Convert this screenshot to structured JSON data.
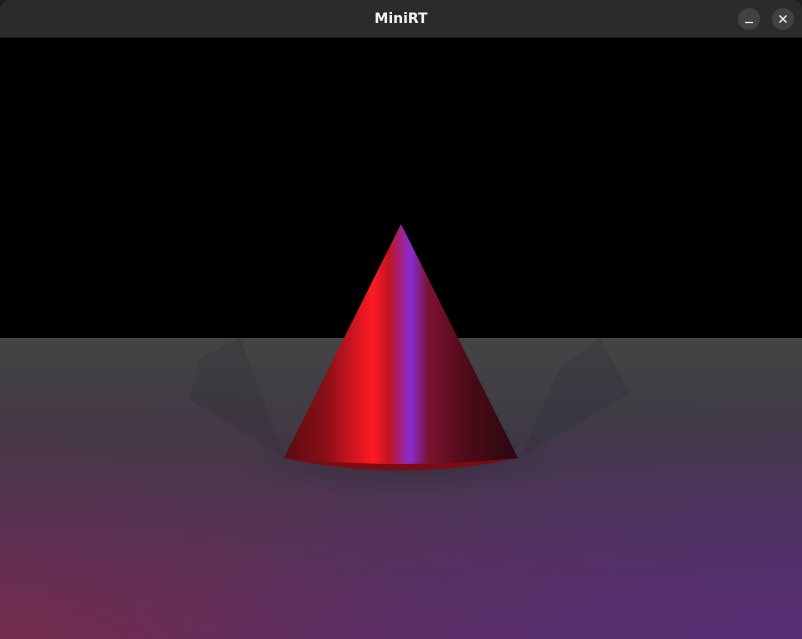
{
  "window": {
    "title": "MiniRT"
  },
  "titlebar_buttons": [
    {
      "name": "minimize",
      "icon": "minimize-icon",
      "glyph": "–"
    },
    {
      "name": "close",
      "icon": "close-icon",
      "glyph": "✕"
    }
  ],
  "scene": {
    "background_color": "#000000",
    "objects": [
      "plane",
      "cone"
    ],
    "cone_color": "#c0101a",
    "plane_color": "#4a4a4a",
    "light_colors": [
      "#ff2020",
      "#7a2ce0"
    ]
  }
}
